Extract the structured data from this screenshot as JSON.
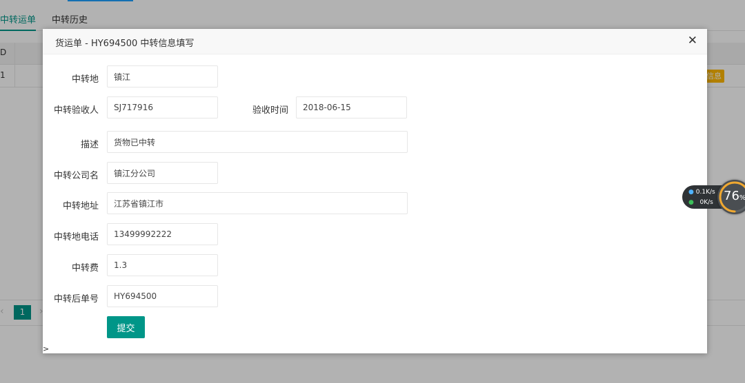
{
  "background": {
    "tabs": [
      "中转运单",
      "中转历史"
    ],
    "table_header_first": "D",
    "table_row_first": "1",
    "row_badge": "信息",
    "pager": {
      "prev": "‹",
      "page": "1",
      "next": "›"
    }
  },
  "modal": {
    "title": "货运单 - HY694500 中转信息填写",
    "close": "✕",
    "fields": {
      "transfer_place": {
        "label": "中转地",
        "value": "镇江"
      },
      "receiver": {
        "label": "中转验收人",
        "value": "SJ717916"
      },
      "receive_time": {
        "label": "验收时间",
        "value": "2018-06-15"
      },
      "description": {
        "label": "描述",
        "value": "货物已中转"
      },
      "company": {
        "label": "中转公司名",
        "value": "镇江分公司"
      },
      "address": {
        "label": "中转地址",
        "value": "江苏省镇江市"
      },
      "phone": {
        "label": "中转地电话",
        "value": "13499992222"
      },
      "fee": {
        "label": "中转费",
        "value": "1.3"
      },
      "new_order": {
        "label": "中转后单号",
        "value": "HY694500"
      }
    },
    "submit": "提交",
    "caret": ">"
  },
  "speed_widget": {
    "up": "0.1",
    "down": "0",
    "unit": "K/s",
    "percent": "76",
    "percent_sign": "%"
  },
  "colors": {
    "accent": "#009688",
    "badge": "#ffb800",
    "tab_indicator": "#1e9fff"
  }
}
